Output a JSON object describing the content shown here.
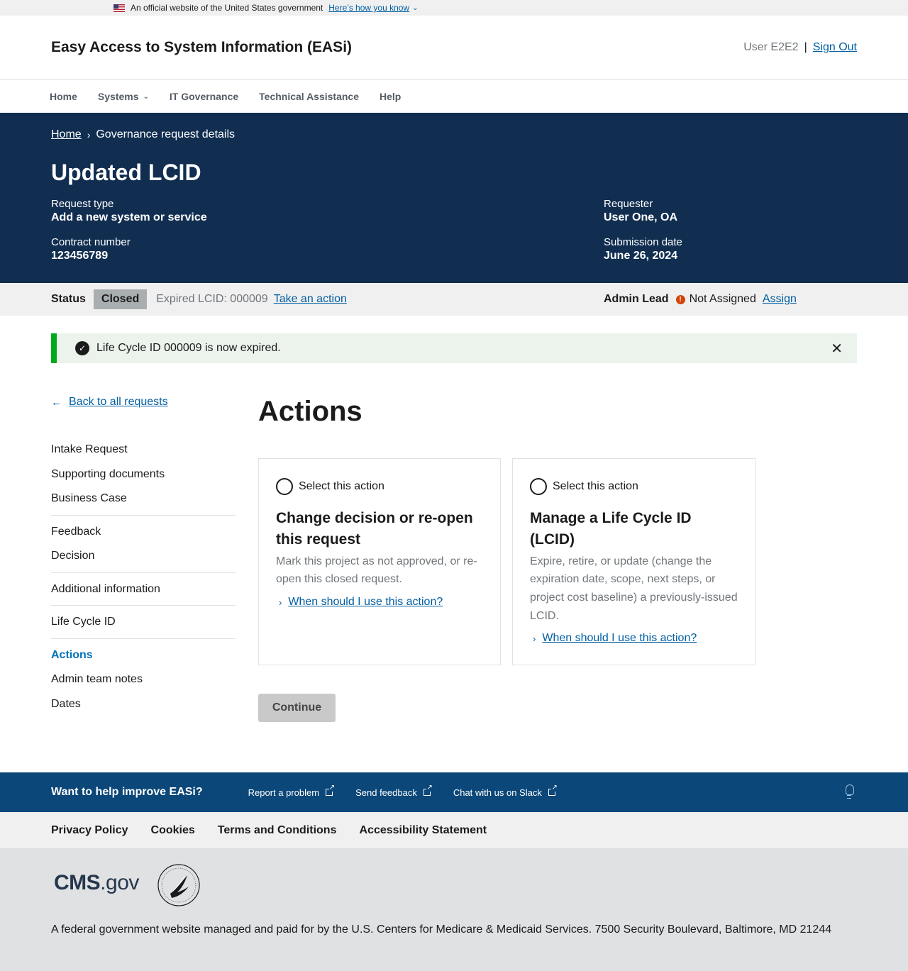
{
  "gov_banner": {
    "text": "An official website of the United States government",
    "link": "Here’s how you know"
  },
  "header": {
    "title": "Easy Access to System Information (EASi)",
    "user": "User E2E2",
    "separator": "|",
    "sign_out": "Sign Out"
  },
  "nav": {
    "items": [
      "Home",
      "Systems",
      "IT Governance",
      "Technical Assistance",
      "Help"
    ]
  },
  "breadcrumb": {
    "home": "Home",
    "current": "Governance request details"
  },
  "request": {
    "title": "Updated LCID",
    "request_type_label": "Request type",
    "request_type": "Add a new system or service",
    "contract_label": "Contract number",
    "contract": "123456789",
    "requester_label": "Requester",
    "requester": "User One, OA",
    "submission_label": "Submission date",
    "submission": "June 26, 2024"
  },
  "status": {
    "label": "Status",
    "badge": "Closed",
    "expired": "Expired LCID: 000009",
    "action_link": "Take an action",
    "admin_label": "Admin Lead",
    "admin_value": "Not Assigned",
    "assign_link": "Assign"
  },
  "alert": {
    "message": "Life Cycle ID 000009 is now expired."
  },
  "sidenav": {
    "back": "Back to all requests",
    "items": [
      "Intake Request",
      "Supporting documents",
      "Business Case",
      "Feedback",
      "Decision",
      "Additional information",
      "Life Cycle ID",
      "Actions",
      "Admin team notes",
      "Dates"
    ],
    "active": "Actions"
  },
  "main": {
    "title": "Actions",
    "cards": [
      {
        "radio_label": "Select this action",
        "title": "Change decision or re-open this request",
        "description": "Mark this project as not approved, or re-open this closed request.",
        "help": "When should I use this action?"
      },
      {
        "radio_label": "Select this action",
        "title": "Manage a Life Cycle ID (LCID)",
        "description": "Expire, retire, or update (change the expiration date, scope, next steps, or project cost baseline) a previously-issued LCID.",
        "help": "When should I use this action?"
      }
    ],
    "continue": "Continue"
  },
  "footer": {
    "feedback_title": "Want to help improve EASi?",
    "links": [
      "Report a problem",
      "Send feedback",
      "Chat with us on Slack"
    ],
    "policy": [
      "Privacy Policy",
      "Cookies",
      "Terms and Conditions",
      "Accessibility Statement"
    ],
    "logo": "CMS.gov",
    "text": "A federal government website managed and paid for by the U.S. Centers for Medicare & Medicaid Services. 7500 Security Boulevard, Baltimore, MD 21244"
  },
  "colors": {
    "hero": "#112e51",
    "footer_bar": "#0b4778",
    "link": "#005ea2",
    "success": "#00a91c",
    "warning": "#d54309"
  }
}
